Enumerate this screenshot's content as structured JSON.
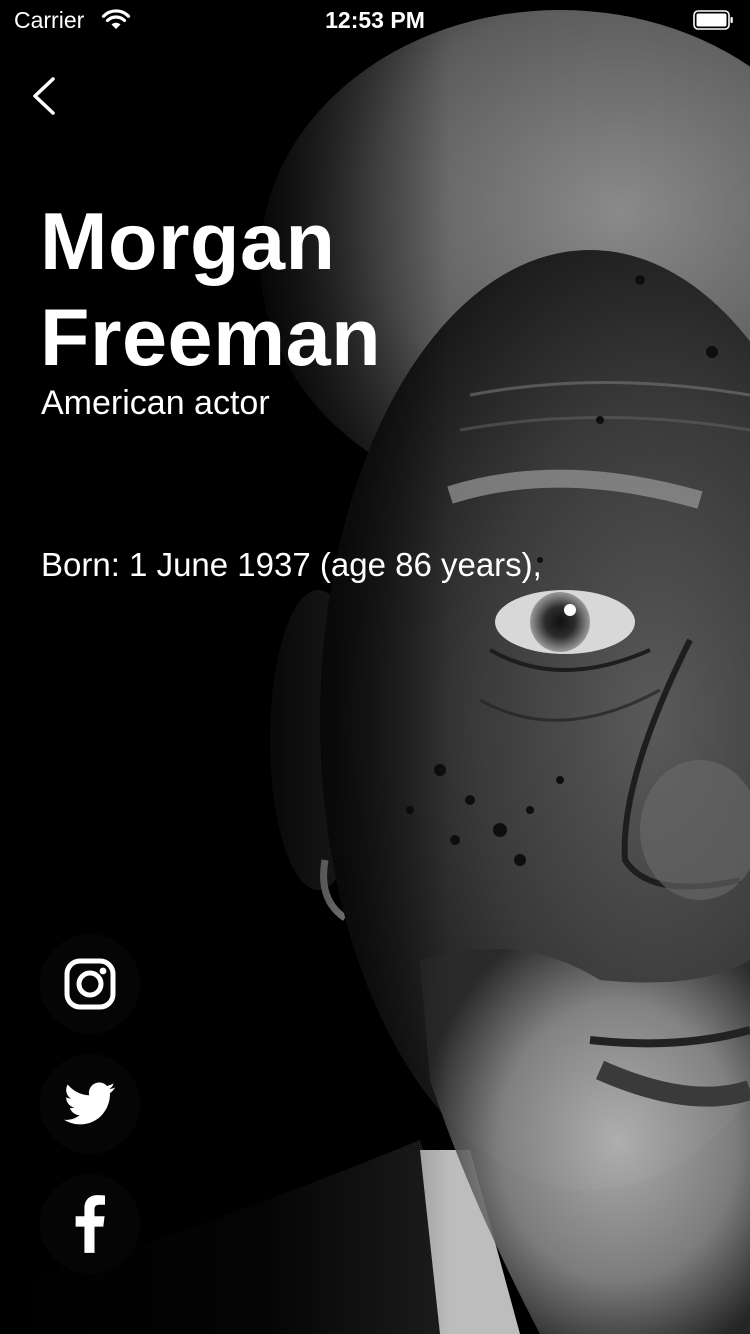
{
  "status_bar": {
    "carrier": "Carrier",
    "time": "12:53 PM",
    "wifi_icon": "wifi-icon",
    "battery_icon": "battery-icon"
  },
  "navigation": {
    "back_icon": "chevron-left-icon"
  },
  "profile": {
    "name_line1": "Morgan",
    "name_line2": "Freeman",
    "subtitle": "American actor",
    "born": "Born: 1 June 1937 (age 86 years),",
    "photo_style": "grayscale portrait"
  },
  "social_links": [
    {
      "icon": "instagram-icon"
    },
    {
      "icon": "twitter-icon"
    },
    {
      "icon": "facebook-icon"
    }
  ],
  "colors": {
    "background": "#000000",
    "text": "#ffffff",
    "social_button_bg": "#050505"
  }
}
